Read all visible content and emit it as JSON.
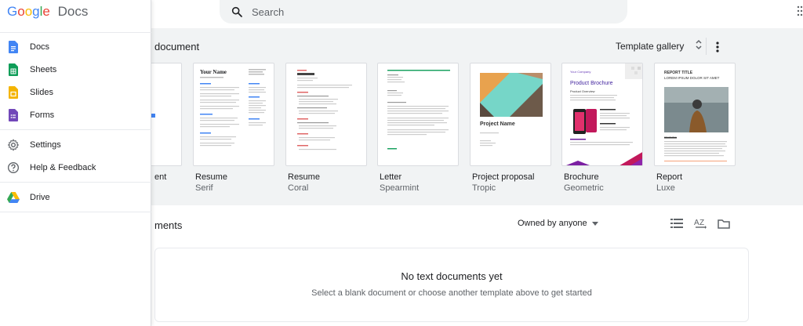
{
  "search": {
    "placeholder": "Search"
  },
  "templates": {
    "section_title": "document",
    "gallery_label": "Template gallery",
    "blank_label": "ent",
    "items": [
      {
        "title": "Resume",
        "subtitle": "Serif"
      },
      {
        "title": "Resume",
        "subtitle": "Coral"
      },
      {
        "title": "Letter",
        "subtitle": "Spearmint"
      },
      {
        "title": "Project proposal",
        "subtitle": "Tropic"
      },
      {
        "title": "Brochure",
        "subtitle": "Geometric"
      },
      {
        "title": "Report",
        "subtitle": "Luxe"
      }
    ],
    "thumbs": {
      "serif_name": "Your Name",
      "proposal_name": "Project Name",
      "brochure_company": "Your Company",
      "brochure_title": "Product Brochure",
      "brochure_overview": "Product Overview",
      "report_title": "REPORT TITLE",
      "report_lorem": "LOREM IPSUM DOLOR SIT AMET",
      "report_intro": "Introduction"
    }
  },
  "recent": {
    "title": "ments",
    "owner_filter": "Owned by anyone",
    "empty_title": "No text documents yet",
    "empty_subtitle": "Select a blank document or choose another template above to get started"
  },
  "sidebar": {
    "logo_google": [
      "G",
      "o",
      "o",
      "g",
      "l",
      "e"
    ],
    "logo_docs": "Docs",
    "items": [
      {
        "label": "Docs",
        "icon": "docs-icon",
        "color": "#4285f4"
      },
      {
        "label": "Sheets",
        "icon": "sheets-icon",
        "color": "#0f9d58"
      },
      {
        "label": "Slides",
        "icon": "slides-icon",
        "color": "#f4b400"
      },
      {
        "label": "Forms",
        "icon": "forms-icon",
        "color": "#7248b9"
      },
      {
        "label": "Settings",
        "icon": "gear-icon"
      },
      {
        "label": "Help & Feedback",
        "icon": "help-icon"
      },
      {
        "label": "Drive",
        "icon": "drive-icon"
      }
    ]
  }
}
